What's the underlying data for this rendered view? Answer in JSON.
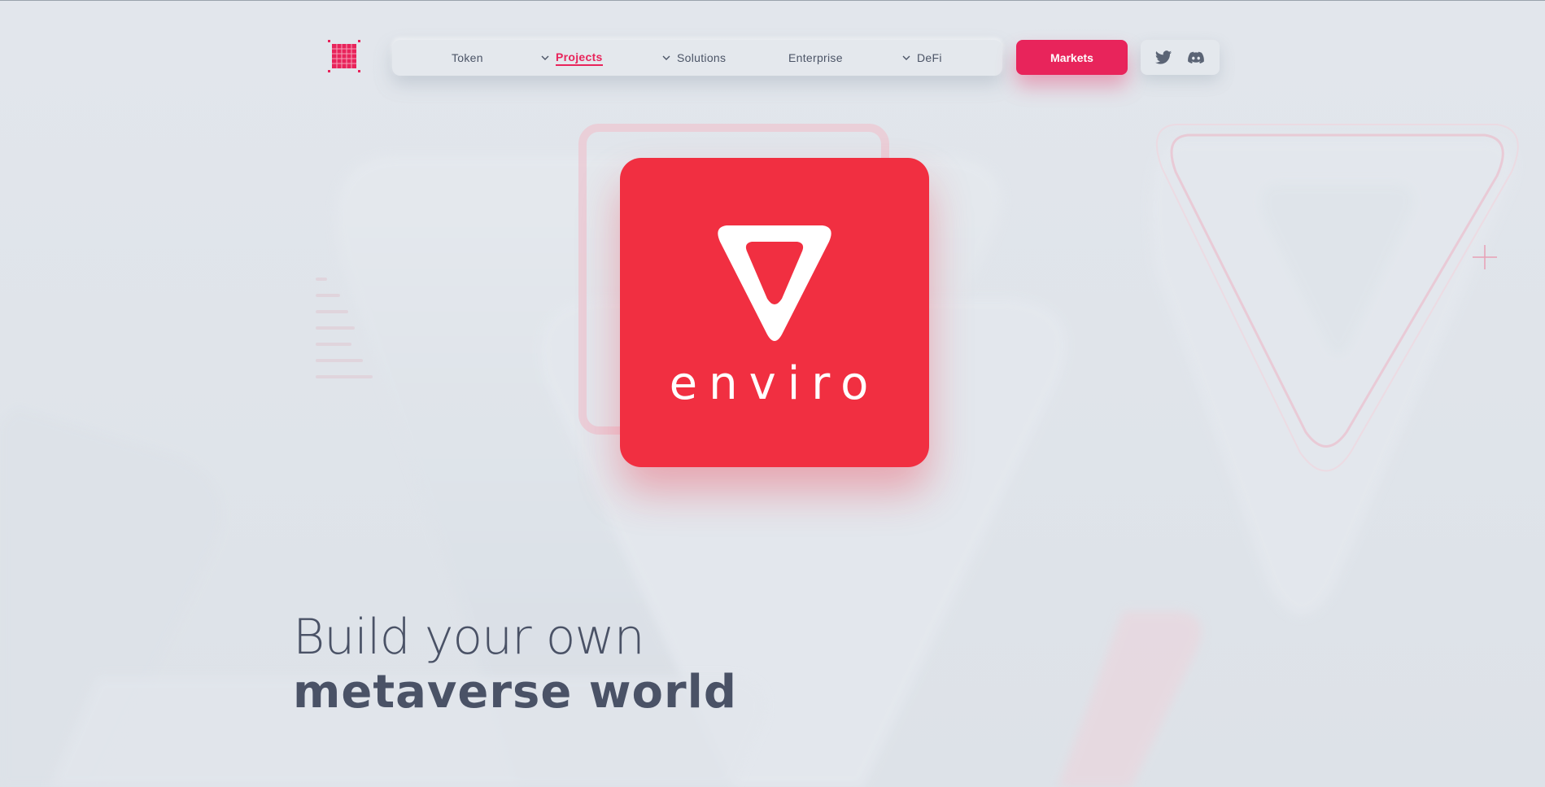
{
  "nav": {
    "items": [
      {
        "label": "Token",
        "has_dropdown": false,
        "active": false
      },
      {
        "label": "Projects",
        "has_dropdown": true,
        "active": true
      },
      {
        "label": "Solutions",
        "has_dropdown": true,
        "active": false
      },
      {
        "label": "Enterprise",
        "has_dropdown": false,
        "active": false
      },
      {
        "label": "DeFi",
        "has_dropdown": true,
        "active": false
      }
    ]
  },
  "markets_button": {
    "label": "Markets"
  },
  "social": [
    {
      "icon": "twitter-icon"
    },
    {
      "icon": "discord-icon"
    }
  ],
  "hero": {
    "brand_word": "enviro",
    "headline_line1": "Build your own",
    "headline_line2": "metaverse world"
  },
  "colors": {
    "accent": "#e8245b",
    "card": "#f12f41",
    "background": "#dfe4ea",
    "text": "#4a5266"
  }
}
